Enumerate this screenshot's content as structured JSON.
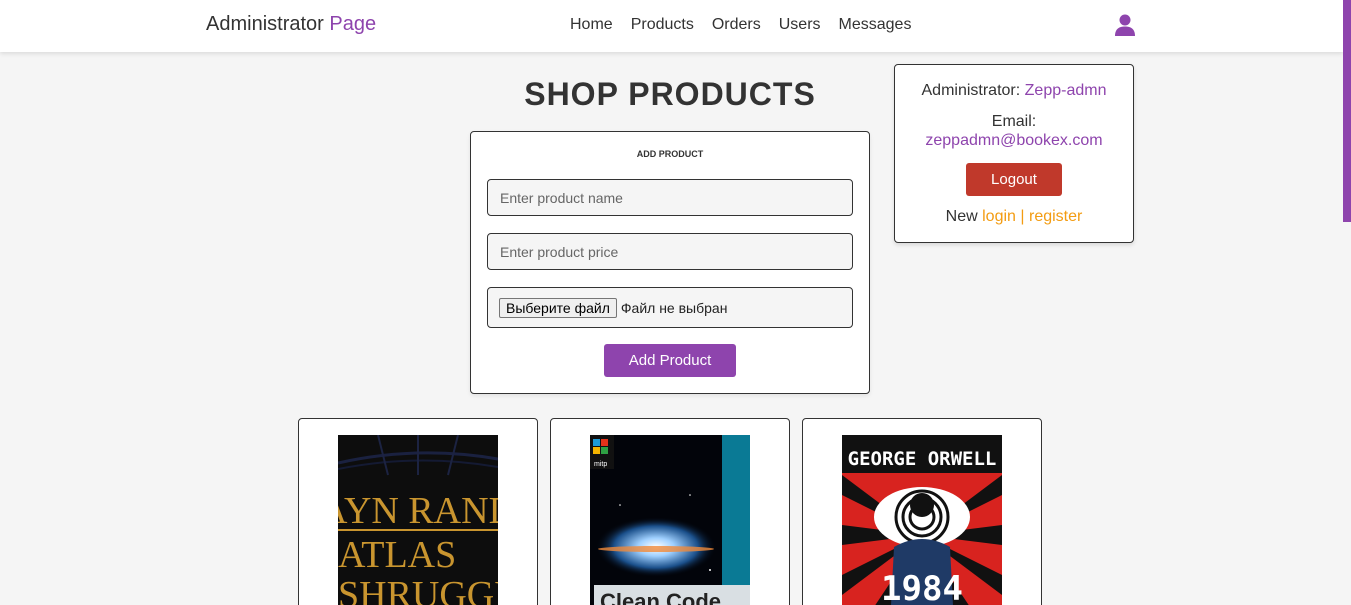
{
  "header": {
    "logo_main": "Administrator",
    "logo_accent": "Page",
    "nav": [
      "Home",
      "Products",
      "Orders",
      "Users",
      "Messages"
    ]
  },
  "title": "SHOP PRODUCTS",
  "add_form": {
    "heading": "ADD PRODUCT",
    "name_placeholder": "Enter product name",
    "price_placeholder": "Enter product price",
    "file_button": "Выберите файл",
    "file_status": "Файл не выбран",
    "submit": "Add Product"
  },
  "profile": {
    "admin_label": "Administrator:",
    "admin_name": "Zepp-admn",
    "email_label": "Email:",
    "email": "zeppadmn@bookex.com",
    "logout": "Logout",
    "new_label": "New",
    "login": "login",
    "separator": "|",
    "register": "register"
  },
  "products": [
    {
      "cover_lines": [
        "AYN RAND",
        "ATLAS",
        "SHRUGGED"
      ]
    },
    {
      "cover_lines": [
        "mitp",
        "Clean Code"
      ]
    },
    {
      "cover_lines": [
        "GEORGE ORWELL",
        "1984"
      ]
    }
  ],
  "colors": {
    "accent": "#8e44ad",
    "logout": "#c0392b",
    "link": "#f39c12",
    "background": "#f5f5f5"
  }
}
